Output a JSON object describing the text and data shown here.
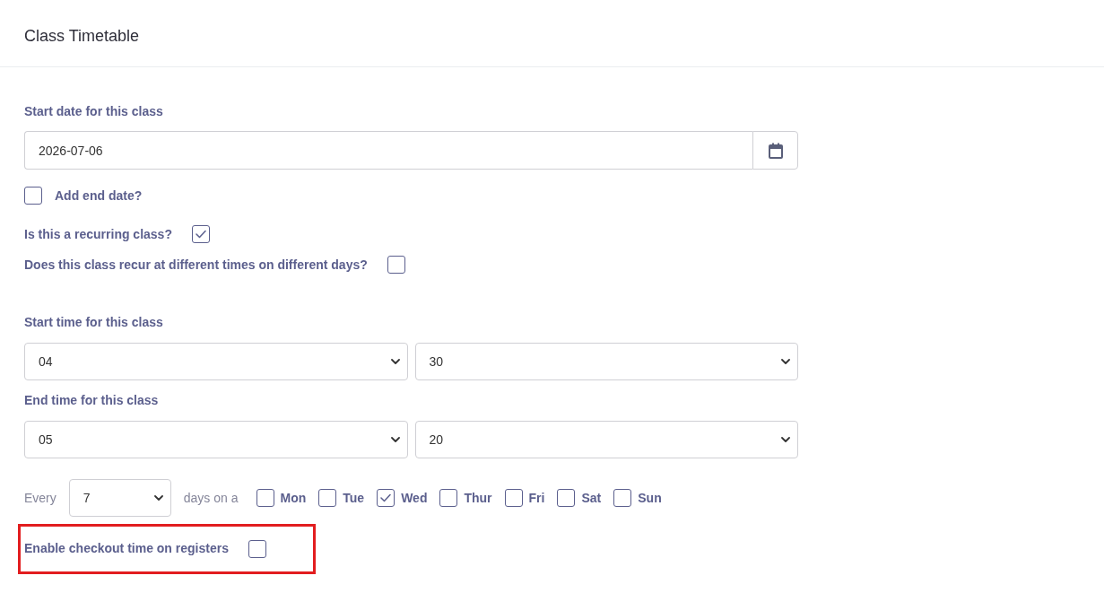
{
  "header": {
    "title": "Class Timetable"
  },
  "start_date": {
    "label": "Start date for this class",
    "value": "2026-07-06"
  },
  "options": [
    {
      "kind": "leading",
      "label": "Add end date?",
      "checked": false
    },
    {
      "kind": "trailing",
      "label": "Is this a recurring class?",
      "checked": true
    },
    {
      "kind": "trailing",
      "label": "Does this class recur at different times on different days?",
      "checked": false
    }
  ],
  "times": [
    {
      "label": "Start time for this class",
      "hour": "04",
      "minute": "30"
    },
    {
      "label": "End time for this class",
      "hour": "05",
      "minute": "20"
    }
  ],
  "recurrence": {
    "every_label": "Every",
    "interval": "7",
    "days_label": "days on a",
    "days": [
      {
        "label": "Mon",
        "checked": false
      },
      {
        "label": "Tue",
        "checked": false
      },
      {
        "label": "Wed",
        "checked": true
      },
      {
        "label": "Thur",
        "checked": false
      },
      {
        "label": "Fri",
        "checked": false
      },
      {
        "label": "Sat",
        "checked": false
      },
      {
        "label": "Sun",
        "checked": false
      }
    ]
  },
  "checkout": {
    "label": "Enable checkout time on registers",
    "checked": false,
    "highlighted": true
  }
}
